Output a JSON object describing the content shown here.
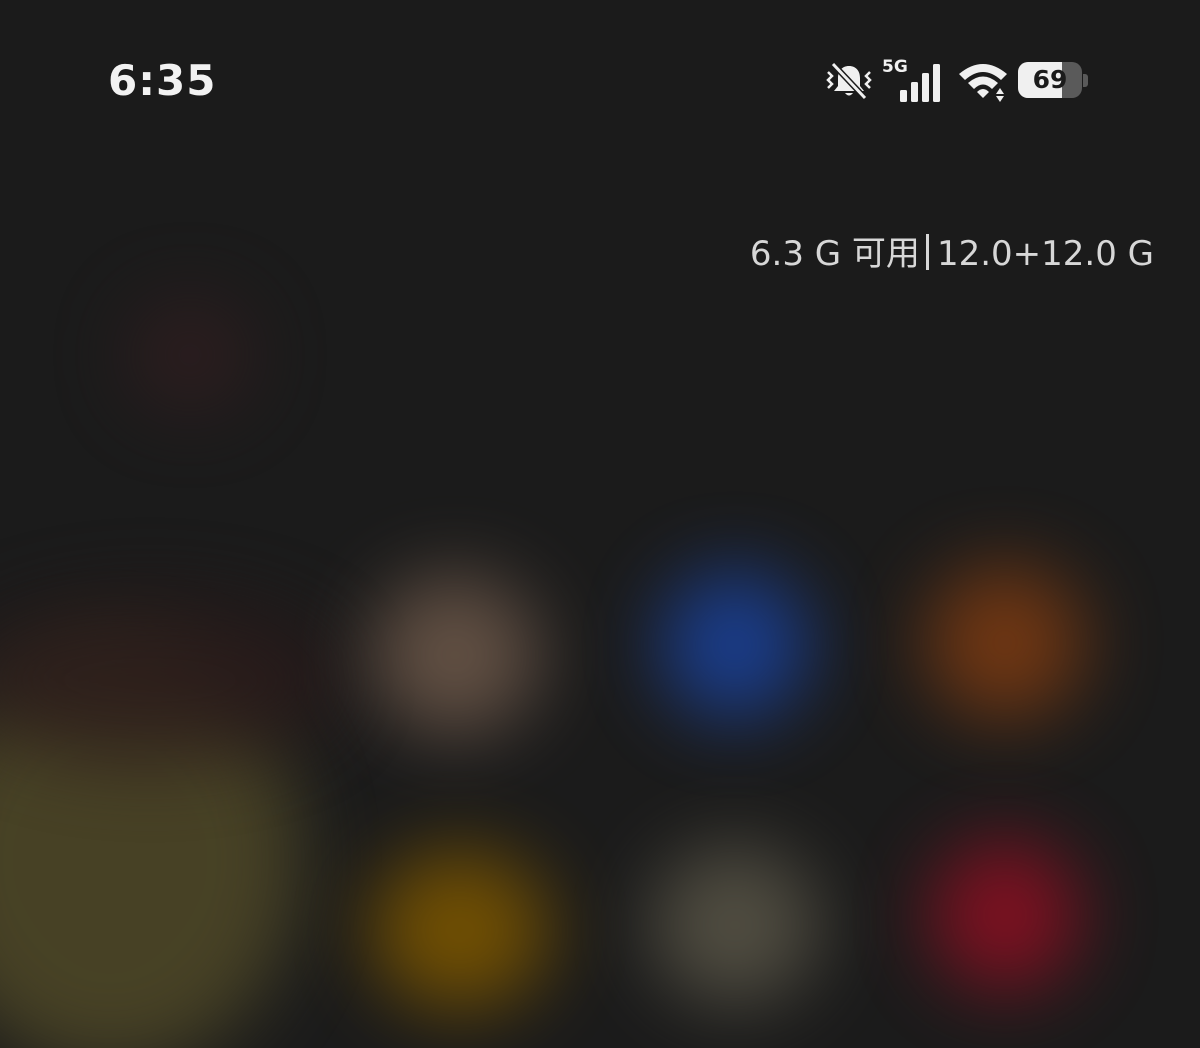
{
  "status_bar": {
    "time": "6:35",
    "network_type": "5G",
    "battery_level": "69",
    "battery_fraction": 0.69,
    "icons": [
      "mute-icon",
      "signal-icon",
      "wifi-icon",
      "battery-icon"
    ]
  },
  "memory": {
    "available": "6.3 G 可用",
    "total": "12.0+12.0 G"
  },
  "colors": {
    "background": "#1b1b1b",
    "text": "#ececec",
    "blur_card_colors": [
      "#3a1f1f",
      "#6a5a4a",
      "#1a3d8a",
      "#7a3a12",
      "#6a5a20",
      "#7a5a00",
      "#5a5a50",
      "#8a1020"
    ]
  }
}
